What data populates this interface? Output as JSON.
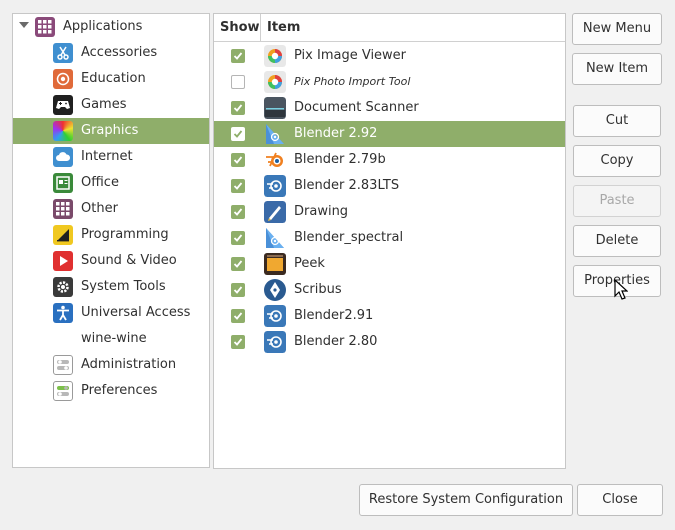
{
  "categories": [
    {
      "label": "Applications",
      "icon": "grid-icon",
      "color": "#8a4a7a",
      "expanded": true,
      "top": true
    },
    {
      "label": "Accessories",
      "icon": "scissors-icon",
      "color": "#3f8fd0"
    },
    {
      "label": "Education",
      "icon": "education-icon",
      "color": "#e06a3a"
    },
    {
      "label": "Games",
      "icon": "gamepad-icon",
      "color": "#202020"
    },
    {
      "label": "Graphics",
      "icon": "palette-icon",
      "color": "#c040c0",
      "selected": true
    },
    {
      "label": "Internet",
      "icon": "cloud-icon",
      "color": "#3f8fd0"
    },
    {
      "label": "Office",
      "icon": "office-icon",
      "color": "#3a8a3a"
    },
    {
      "label": "Other",
      "icon": "grid-icon",
      "color": "#7a4a6a"
    },
    {
      "label": "Programming",
      "icon": "programming-icon",
      "color": "#d0b020"
    },
    {
      "label": "Sound & Video",
      "icon": "play-icon",
      "color": "#e03030"
    },
    {
      "label": "System Tools",
      "icon": "gear-icon",
      "color": "#3a3a3a"
    },
    {
      "label": "Universal Access",
      "icon": "accessibility-icon",
      "color": "#2a70c0"
    },
    {
      "label": "wine-wine",
      "icon": "",
      "color": ""
    },
    {
      "label": "Administration",
      "icon": "toggle-icon",
      "color": "#9a9a9a"
    },
    {
      "label": "Preferences",
      "icon": "toggle-green-icon",
      "color": "#9a9a9a"
    }
  ],
  "list": {
    "header_show": "Show",
    "header_item": "Item",
    "items": [
      {
        "label": "Pix Image Viewer",
        "shown": true,
        "icon": "pix-icon"
      },
      {
        "label": "Pix Photo Import Tool",
        "shown": false,
        "icon": "pix-icon",
        "italic": true
      },
      {
        "label": "Document Scanner",
        "shown": true,
        "icon": "scanner-icon"
      },
      {
        "label": "Blender 2.92",
        "shown": true,
        "icon": "blender-spectral-icon",
        "selected": true
      },
      {
        "label": "Blender 2.79b",
        "shown": true,
        "icon": "blender-logo-icon"
      },
      {
        "label": "Blender 2.83LTS",
        "shown": true,
        "icon": "blender-icon"
      },
      {
        "label": "Drawing",
        "shown": true,
        "icon": "drawing-icon"
      },
      {
        "label": "Blender_spectral",
        "shown": true,
        "icon": "blender-spectral-icon"
      },
      {
        "label": "Peek",
        "shown": true,
        "icon": "peek-icon"
      },
      {
        "label": "Scribus",
        "shown": true,
        "icon": "scribus-icon"
      },
      {
        "label": "Blender2.91",
        "shown": true,
        "icon": "blender-icon"
      },
      {
        "label": "Blender 2.80",
        "shown": true,
        "icon": "blender-icon"
      }
    ]
  },
  "buttons": {
    "new_menu": "New Menu",
    "new_item": "New Item",
    "cut": "Cut",
    "copy": "Copy",
    "paste": "Paste",
    "delete": "Delete",
    "properties": "Properties",
    "restore": "Restore System Configuration",
    "close": "Close"
  },
  "colors": {
    "selection": "#8fae6a",
    "check": "#8fae6a"
  }
}
